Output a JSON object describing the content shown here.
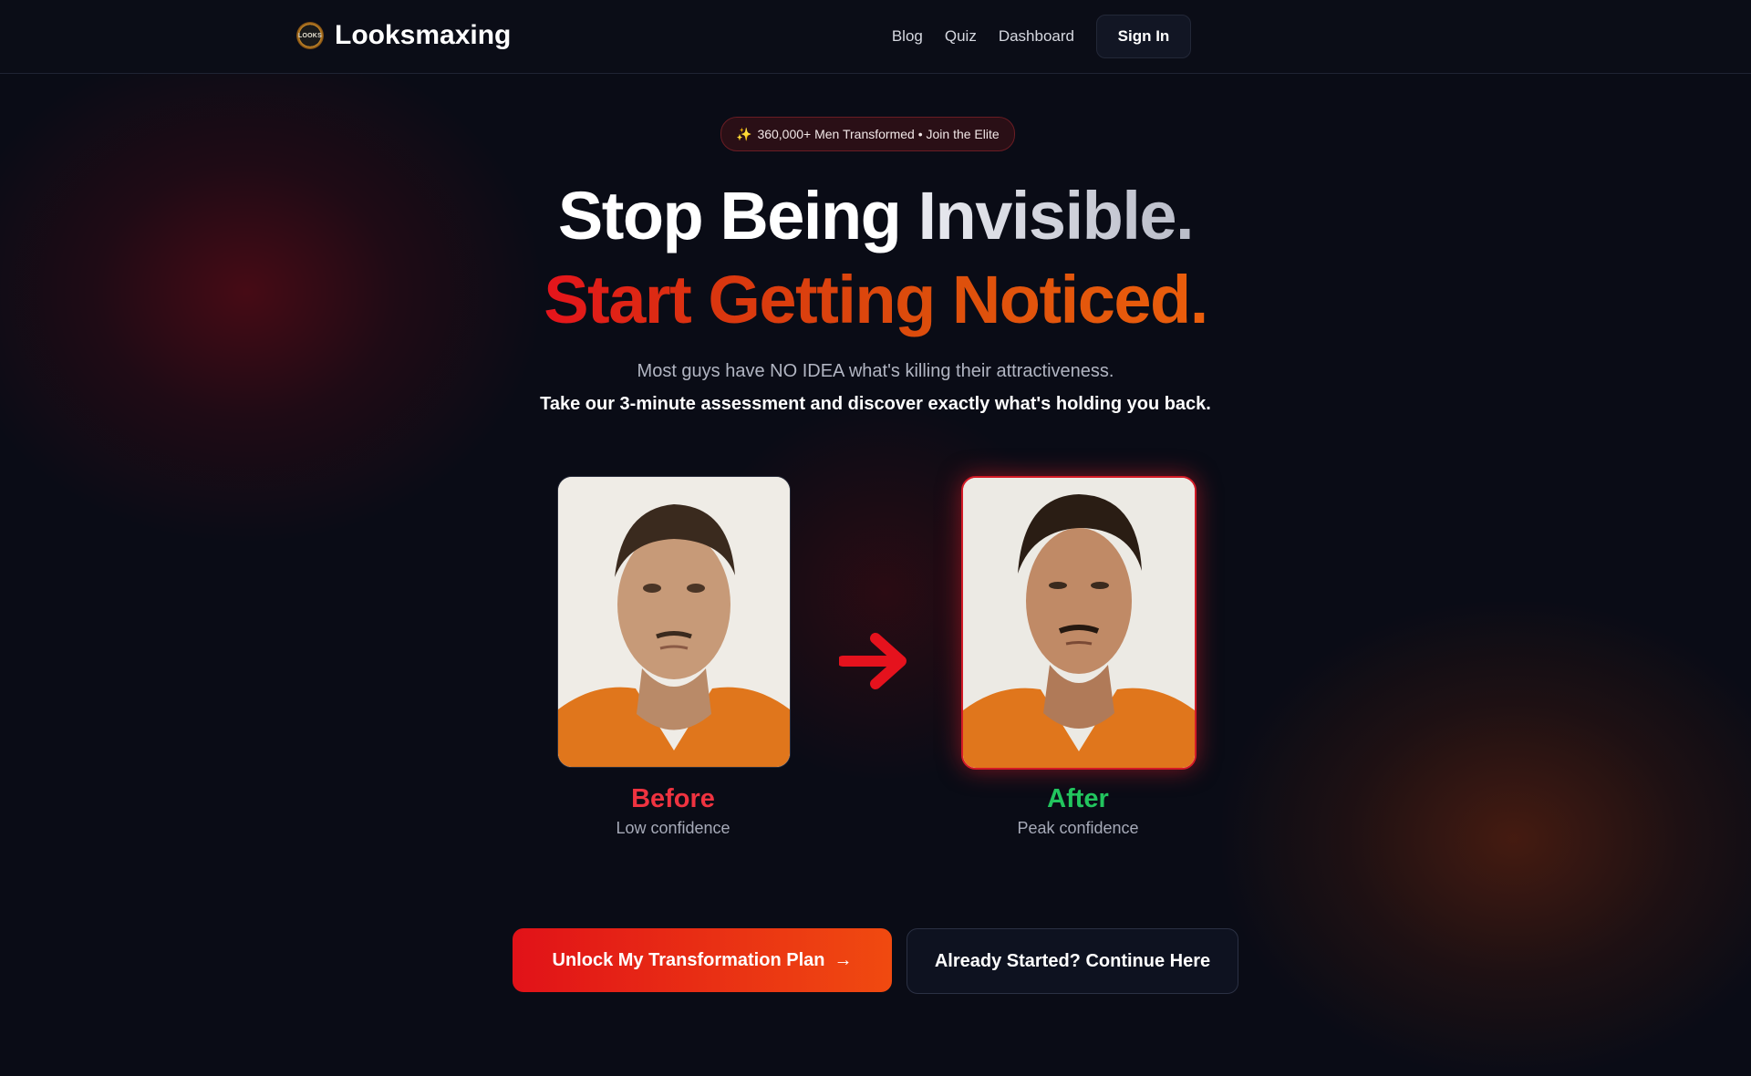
{
  "header": {
    "logo_text": "LOOKS",
    "brand": "Looksmaxing",
    "nav": [
      {
        "label": "Blog"
      },
      {
        "label": "Quiz"
      },
      {
        "label": "Dashboard"
      }
    ],
    "signin_label": "Sign In"
  },
  "hero": {
    "badge_icon": "✨",
    "badge": "360,000+ Men Transformed • Join the Elite",
    "headline_1a": "Stop Being",
    "headline_1b": "Invisible.",
    "headline_2": "Start Getting Noticed.",
    "sub_1": "Most guys have NO IDEA what's killing their attractiveness.",
    "sub_2": "Take our 3-minute assessment and discover exactly what's holding you back."
  },
  "comparison": {
    "before_title": "Before",
    "before_sub": "Low confidence",
    "after_title": "After",
    "after_sub": "Peak confidence",
    "arrow_icon": "arrow-right-icon"
  },
  "cta": {
    "primary_label": "Unlock My Transformation Plan",
    "primary_icon": "→",
    "secondary_label": "Already Started? Continue Here"
  },
  "colors": {
    "background": "#0a0c16",
    "accent_red": "#e11218",
    "accent_orange": "#f04a10",
    "before_red": "#ef3340",
    "after_green": "#22c55e"
  }
}
